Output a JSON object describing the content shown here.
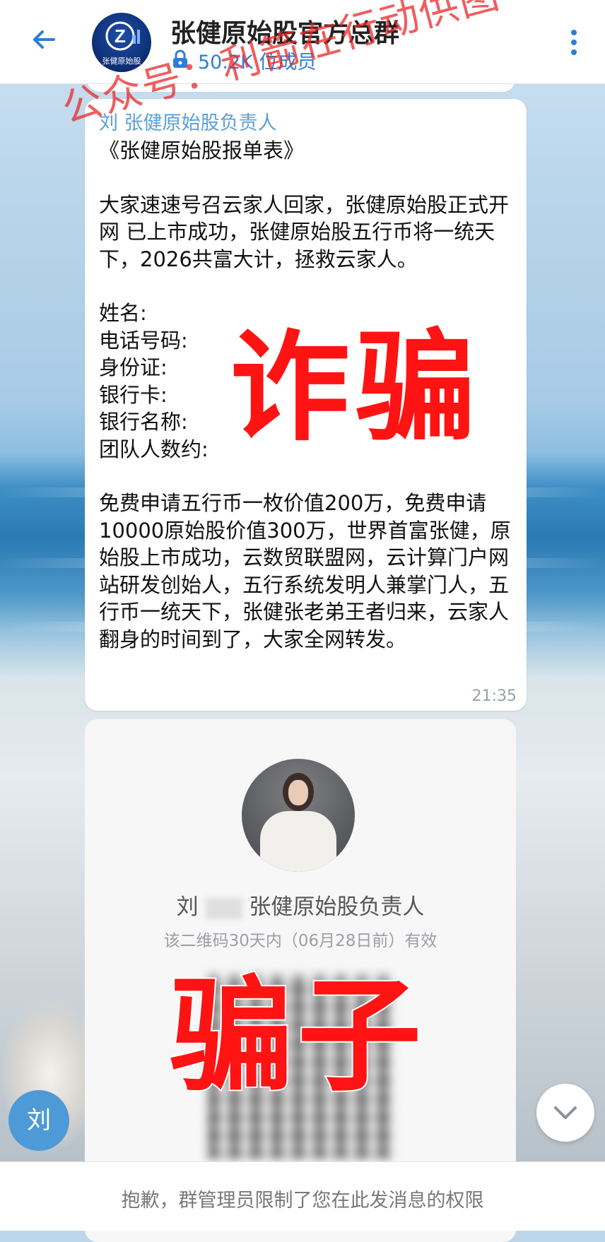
{
  "header": {
    "group_name": "张健原始股官方总群",
    "member_count": "50.2K 位成员",
    "logo_letter": "Z",
    "logo_caption": "张健原始股"
  },
  "watermark": "公众号：利箭在行动供图",
  "message": {
    "sender": "刘    张健原始股负责人",
    "title": "《张健原始股报单表》",
    "paragraph1": "大家速速号召云家人回家，张健原始股正式开网 已上市成功，张健原始股五行币将一统天下，2026共富大计，拯救云家人。",
    "fields": [
      "姓名:",
      "电话号码:",
      "身份证:",
      "银行卡:",
      "银行名称:",
      "团队人数约:"
    ],
    "paragraph2": "免费申请五行币一枚价值200万，免费申请10000原始股价值300万，世界首富张健，原始股上市成功，云数贸联盟网，云计算门户网站研发创始人，五行系统发明人兼掌门人，五行币一统天下，张健张老弟王者归来，云家人翻身的时间到了，大家全网转发。",
    "time": "21:35"
  },
  "contact_card": {
    "name_prefix": "刘",
    "name_suffix": "张健原始股负责人",
    "qr_validity": "该二维码30天内（06月28日前）有效"
  },
  "overlays": {
    "fraud": "诈骗",
    "scammer": "骗子"
  },
  "side_avatar_letter": "刘",
  "bottom_notice": "抱歉，群管理员限制了您在此发消息的权限",
  "colors": {
    "accent": "#2e7ed6",
    "sender": "#5aa0d8",
    "stamp_red": "#ff1313",
    "watermark_red": "#e82828"
  }
}
